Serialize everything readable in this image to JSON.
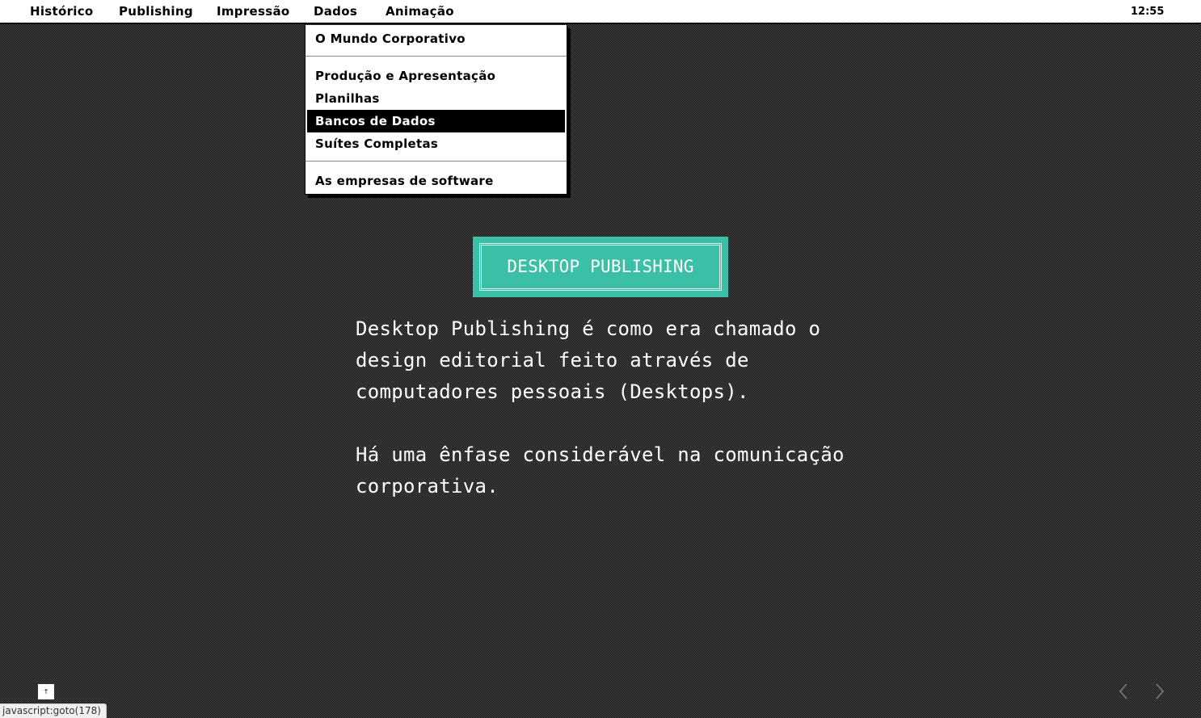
{
  "menubar": {
    "items": [
      {
        "label": "Histórico"
      },
      {
        "label": "Publishing"
      },
      {
        "label": "Impressão"
      },
      {
        "label": "Dados"
      },
      {
        "label": "Animação"
      }
    ],
    "clock": "12:55"
  },
  "dropdown": {
    "items": [
      {
        "label": "O Mundo Corporativo"
      },
      {
        "label": "Produção e Apresentação"
      },
      {
        "label": "Planilhas"
      },
      {
        "label": "Bancos de Dados"
      },
      {
        "label": "Suítes Completas"
      },
      {
        "label": "As empresas de software"
      }
    ],
    "selected": "Bancos de Dados"
  },
  "content": {
    "title": "DESKTOP PUBLISHING",
    "paragraphs": [
      "Desktop Publishing é como era chamado o design editorial feito através de computadores pessoais (Desktops).",
      "Há uma ênfase considerável na comunicação corporativa."
    ]
  },
  "footer": {
    "corner_button": "↑",
    "status_text": "javascript:goto(178)",
    "prev_icon": "chevron-left-icon",
    "next_icon": "chevron-right-icon"
  },
  "colors": {
    "accent": "#3bbfa6",
    "menu_bg": "#ffffff",
    "selected_bg": "#000000",
    "text_light": "#ffffff"
  }
}
